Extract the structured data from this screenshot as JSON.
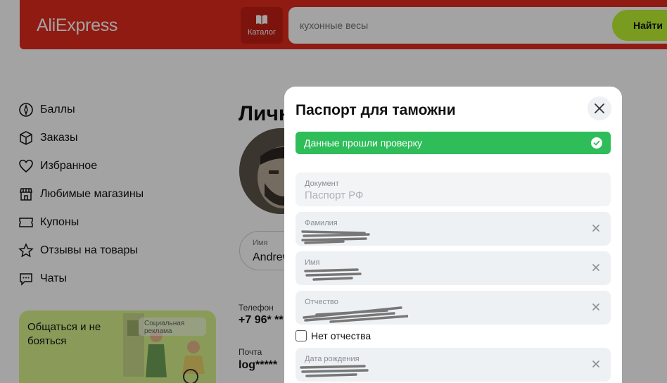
{
  "header": {
    "logo": "AliExpress",
    "catalog_label": "Каталог",
    "search_placeholder": "кухонные весы",
    "search_button": "Найти",
    "brand_color": "#e22b1d",
    "search_button_color": "#bef232"
  },
  "sidebar": {
    "items": [
      {
        "label": "Баллы",
        "icon": "points-icon"
      },
      {
        "label": "Заказы",
        "icon": "box-icon"
      },
      {
        "label": "Избранное",
        "icon": "heart-icon"
      },
      {
        "label": "Любимые магазины",
        "icon": "store-icon"
      },
      {
        "label": "Купоны",
        "icon": "coupon-icon"
      },
      {
        "label": "Отзывы на товары",
        "icon": "star-icon"
      },
      {
        "label": "Чаты",
        "icon": "chat-icon"
      }
    ],
    "promo": {
      "text": "Общаться и не бояться",
      "badge": "Социальная реклама"
    }
  },
  "profile": {
    "title": "Личн",
    "name_label": "Имя",
    "name_value": "Andrew",
    "phone_label": "Телефон",
    "phone_value": "+7 96* **",
    "email_label": "Почта",
    "email_value": "log*****"
  },
  "modal": {
    "title": "Паспорт для таможни",
    "verified_text": "Данные прошли проверку",
    "verified_color": "#2fbd5a",
    "document_label": "Документ",
    "document_value": "Паспорт РФ",
    "fields": [
      {
        "label": "Фамилия"
      },
      {
        "label": "Имя"
      },
      {
        "label": "Отчество"
      }
    ],
    "no_patronymic_label": "Нет отчества",
    "birthdate_label": "Дата рождения"
  }
}
